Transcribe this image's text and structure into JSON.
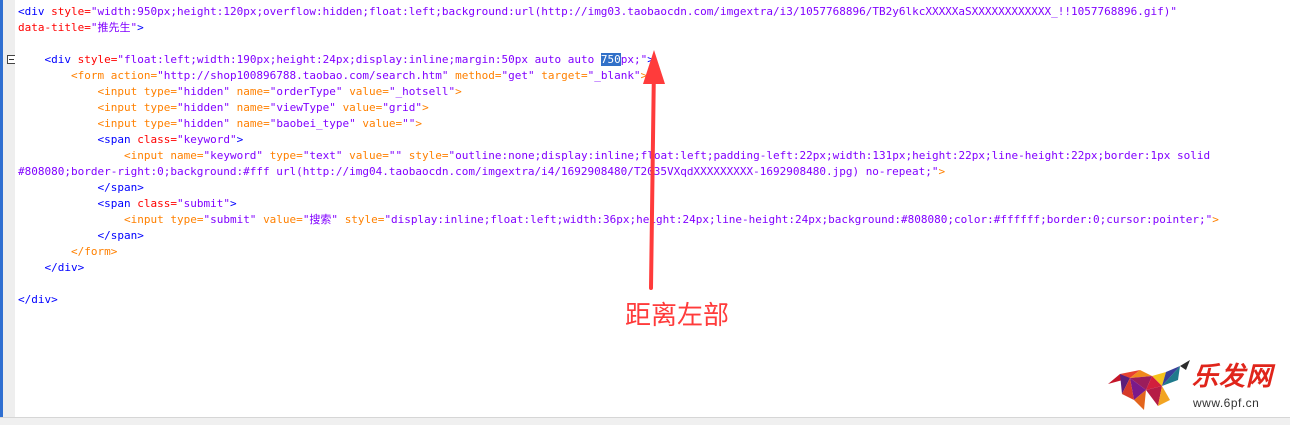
{
  "editor": {
    "lines": [
      [
        {
          "c": "tg",
          "t": "<div "
        },
        {
          "c": "at",
          "t": "style="
        },
        {
          "c": "vl",
          "t": "\"width:950px;height:120px;overflow:hidden;float:left;background:url(http://img03.taobaocdn.com/imgextra/i3/1057768896/TB2y6lkcXXXXXaSXXXXXXXXXXXX_!!1057768896.gif)\""
        }
      ],
      [
        {
          "c": "at",
          "t": "data-title="
        },
        {
          "c": "vl",
          "t": "\"推先生\""
        },
        {
          "c": "tg",
          "t": ">"
        }
      ],
      [],
      [
        {
          "c": "tx",
          "t": "    "
        },
        {
          "c": "tg",
          "t": "<div "
        },
        {
          "c": "at",
          "t": "style="
        },
        {
          "c": "vl",
          "t": "\"float:left;width:190px;height:24px;display:inline;margin:50px auto auto "
        },
        {
          "c": "sel",
          "t": "750"
        },
        {
          "c": "vl",
          "t": "px;\""
        },
        {
          "c": "tg",
          "t": ">"
        }
      ],
      [
        {
          "c": "tx",
          "t": "        "
        },
        {
          "c": "ft",
          "t": "<form "
        },
        {
          "c": "ft",
          "t": "action="
        },
        {
          "c": "vl",
          "t": "\"http://shop100896788.taobao.com/search.htm\" "
        },
        {
          "c": "ft",
          "t": "method="
        },
        {
          "c": "vl",
          "t": "\"get\" "
        },
        {
          "c": "ft",
          "t": "target="
        },
        {
          "c": "vl",
          "t": "\"_blank\""
        },
        {
          "c": "ft",
          "t": ">"
        }
      ],
      [
        {
          "c": "tx",
          "t": "            "
        },
        {
          "c": "ft",
          "t": "<input "
        },
        {
          "c": "ft",
          "t": "type="
        },
        {
          "c": "vl",
          "t": "\"hidden\" "
        },
        {
          "c": "ft",
          "t": "name="
        },
        {
          "c": "vl",
          "t": "\"orderType\" "
        },
        {
          "c": "ft",
          "t": "value="
        },
        {
          "c": "vl",
          "t": "\"_hotsell\""
        },
        {
          "c": "ft",
          "t": ">"
        }
      ],
      [
        {
          "c": "tx",
          "t": "            "
        },
        {
          "c": "ft",
          "t": "<input "
        },
        {
          "c": "ft",
          "t": "type="
        },
        {
          "c": "vl",
          "t": "\"hidden\" "
        },
        {
          "c": "ft",
          "t": "name="
        },
        {
          "c": "vl",
          "t": "\"viewType\" "
        },
        {
          "c": "ft",
          "t": "value="
        },
        {
          "c": "vl",
          "t": "\"grid\""
        },
        {
          "c": "ft",
          "t": ">"
        }
      ],
      [
        {
          "c": "tx",
          "t": "            "
        },
        {
          "c": "ft",
          "t": "<input "
        },
        {
          "c": "ft",
          "t": "type="
        },
        {
          "c": "vl",
          "t": "\"hidden\" "
        },
        {
          "c": "ft",
          "t": "name="
        },
        {
          "c": "vl",
          "t": "\"baobei_type\" "
        },
        {
          "c": "ft",
          "t": "value="
        },
        {
          "c": "vl",
          "t": "\"\""
        },
        {
          "c": "ft",
          "t": ">"
        }
      ],
      [
        {
          "c": "tx",
          "t": "            "
        },
        {
          "c": "tg",
          "t": "<span "
        },
        {
          "c": "at",
          "t": "class="
        },
        {
          "c": "vl",
          "t": "\"keyword\""
        },
        {
          "c": "tg",
          "t": ">"
        }
      ],
      [
        {
          "c": "tx",
          "t": "                "
        },
        {
          "c": "ft",
          "t": "<input "
        },
        {
          "c": "ft",
          "t": "name="
        },
        {
          "c": "vl",
          "t": "\"keyword\" "
        },
        {
          "c": "ft",
          "t": "type="
        },
        {
          "c": "vl",
          "t": "\"text\" "
        },
        {
          "c": "ft",
          "t": "value="
        },
        {
          "c": "vl",
          "t": "\"\" "
        },
        {
          "c": "ft",
          "t": "style="
        },
        {
          "c": "vl",
          "t": "\"outline:none;display:inline;float:left;padding-left:22px;width:131px;height:22px;line-height:22px;border:1px solid"
        }
      ],
      [
        {
          "c": "vl",
          "t": "#808080;border-right:0;background:#fff url(http://img04.taobaocdn.com/imgextra/i4/1692908480/T2035VXqdXXXXXXXXX-1692908480.jpg) no-repeat;\""
        },
        {
          "c": "ft",
          "t": ">"
        }
      ],
      [
        {
          "c": "tx",
          "t": "            "
        },
        {
          "c": "tg",
          "t": "</span>"
        }
      ],
      [
        {
          "c": "tx",
          "t": "            "
        },
        {
          "c": "tg",
          "t": "<span "
        },
        {
          "c": "at",
          "t": "class="
        },
        {
          "c": "vl",
          "t": "\"submit\""
        },
        {
          "c": "tg",
          "t": ">"
        }
      ],
      [
        {
          "c": "tx",
          "t": "                "
        },
        {
          "c": "ft",
          "t": "<input "
        },
        {
          "c": "ft",
          "t": "type="
        },
        {
          "c": "vl",
          "t": "\"submit\" "
        },
        {
          "c": "ft",
          "t": "value="
        },
        {
          "c": "vl",
          "t": "\"搜索\" "
        },
        {
          "c": "ft",
          "t": "style="
        },
        {
          "c": "vl",
          "t": "\"display:inline;float:left;width:36px;height:24px;line-height:24px;background:#808080;color:#ffffff;border:0;cursor:pointer;\""
        },
        {
          "c": "ft",
          "t": ">"
        }
      ],
      [
        {
          "c": "tx",
          "t": "            "
        },
        {
          "c": "tg",
          "t": "</span>"
        }
      ],
      [
        {
          "c": "tx",
          "t": "        "
        },
        {
          "c": "ft",
          "t": "</form>"
        }
      ],
      [
        {
          "c": "tx",
          "t": "    "
        },
        {
          "c": "tg",
          "t": "</div>"
        }
      ],
      [],
      [
        {
          "c": "tg",
          "t": "</div>"
        }
      ]
    ]
  },
  "annotation": {
    "text": "距离左部",
    "color": "#ff3b3b"
  },
  "watermark": {
    "title": "乐发网",
    "url": "www.6pf.cn",
    "icon": "bull-logo-icon"
  },
  "colors": {
    "tag": "#0000ff",
    "attribute": "#ff0000",
    "form_tag": "#ff8000",
    "value": "#8000ff",
    "selection": "#3170c8",
    "gutter": "#2f6fd1"
  }
}
